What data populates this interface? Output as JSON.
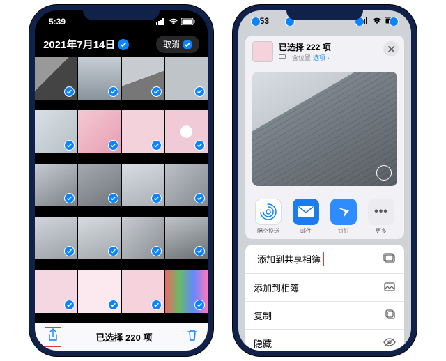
{
  "left": {
    "time": "5:39",
    "date_title": "2021年7月14日",
    "cancel": "取消",
    "selected_count": "已选择 220 项"
  },
  "right": {
    "time": "1:53",
    "sheet_title": "已选择 222 项",
    "sheet_sub_loc": "含位置",
    "sheet_sub_link": "选项",
    "share_apps": {
      "airdrop": "隔空投送",
      "mail": "邮件",
      "dingtalk": "钉钉",
      "more": "更多"
    },
    "actions": {
      "add_shared": "添加到共享相簿",
      "add_album": "添加到相簿",
      "copy": "复制",
      "hide": "隐藏"
    }
  }
}
